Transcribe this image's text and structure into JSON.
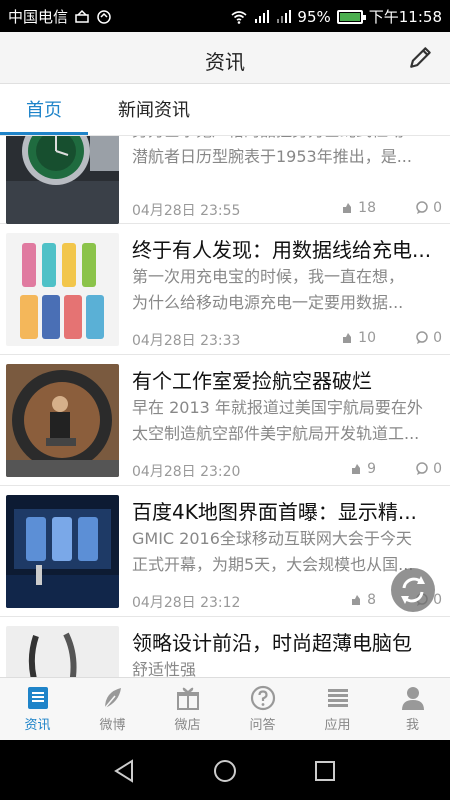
{
  "status_bar": {
    "carrier": "中国电信",
    "battery": "95%",
    "time": "下午11:58",
    "battery_color": "#4CAF50"
  },
  "header": {
    "title": "资讯",
    "edit_icon": "pencil-icon"
  },
  "tabs": [
    {
      "label": "首页",
      "active": true
    },
    {
      "label": "新闻资讯",
      "active": false
    }
  ],
  "articles": [
    {
      "title": "",
      "summary_lines": [
        "劳力士水鬼严格的品控劳力士蚝式恒动",
        "潜航者日历型腕表于1953年推出，是..."
      ],
      "date": "04月28日 23:55",
      "likes": "18",
      "comments": "0"
    },
    {
      "title": "终于有人发现：用数据线给充电...",
      "summary_lines": [
        "第一次用充电宝的时候，我一直在想，",
        "为什么给移动电源充电一定要用数据..."
      ],
      "date": "04月28日 23:33",
      "likes": "10",
      "comments": "0"
    },
    {
      "title": "有个工作室爱捡航空器破烂",
      "summary_lines": [
        "早在 2013 年就报道过美国宇航局要在外",
        "太空制造航空部件美宇航局开发轨道工..."
      ],
      "date": "04月28日 23:20",
      "likes": "9",
      "comments": "0"
    },
    {
      "title": "百度4K地图界面首曝：显示精...",
      "summary_lines": [
        "GMIC 2016全球移动互联网大会于今天",
        "正式开幕，为期5天，大会规模也从国..."
      ],
      "date": "04月28日 23:12",
      "likes": "8",
      "comments": "0"
    },
    {
      "title": "领略设计前沿，时尚超薄电脑包",
      "summary_lines": [
        "舒适性强"
      ],
      "date": "",
      "likes": "",
      "comments": ""
    }
  ],
  "bottom_nav": [
    {
      "label": "资讯",
      "icon": "news-icon",
      "active": true
    },
    {
      "label": "微博",
      "icon": "feather-icon",
      "active": false
    },
    {
      "label": "微店",
      "icon": "gift-icon",
      "active": false
    },
    {
      "label": "问答",
      "icon": "question-icon",
      "active": false
    },
    {
      "label": "应用",
      "icon": "apps-icon",
      "active": false
    },
    {
      "label": "我",
      "icon": "person-icon",
      "active": false
    }
  ],
  "colors": {
    "accent": "#1f84c9",
    "meta_text": "#999999",
    "summary_text": "#888888"
  }
}
